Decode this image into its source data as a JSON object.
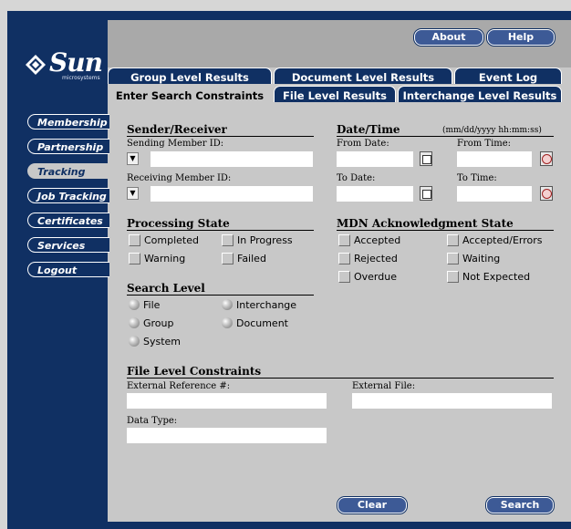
{
  "logo": {
    "word": "Sun",
    "sub": "microsystems"
  },
  "topbar": {
    "about": "About",
    "help": "Help"
  },
  "nav": [
    "Membership",
    "Partnership",
    "Tracking",
    "Job Tracking",
    "Certificates",
    "Services",
    "Logout"
  ],
  "tabs": {
    "row1": [
      "Group Level Results",
      "Document Level Results",
      "Event Log"
    ],
    "row2": [
      "Enter Search Constraints",
      "File Level Results",
      "Interchange Level Results"
    ]
  },
  "sender": {
    "title": "Sender/Receiver",
    "sending_label": "Sending Member ID:",
    "receiving_label": "Receiving Member ID:",
    "sending_value": "",
    "receiving_value": ""
  },
  "datetime": {
    "title": "Date/Time",
    "format": "(mm/dd/yyyy hh:mm:ss)",
    "from_date": "From Date:",
    "from_time": "From Time:",
    "to_date": "To Date:",
    "to_time": "To Time:"
  },
  "processing": {
    "title": "Processing State",
    "options": [
      "Completed",
      "In Progress",
      "Warning",
      "Failed"
    ]
  },
  "mdn": {
    "title": "MDN Acknowledgment State",
    "options": [
      "Accepted",
      "Accepted/Errors",
      "Rejected",
      "Waiting",
      "Overdue",
      "Not Expected"
    ]
  },
  "search_level": {
    "title": "Search Level",
    "options": [
      "File",
      "Interchange",
      "Group",
      "Document",
      "System"
    ]
  },
  "file_level": {
    "title": "File Level Constraints",
    "ext_ref": "External Reference #:",
    "ext_file": "External File:",
    "data_type": "Data Type:"
  },
  "buttons": {
    "clear": "Clear",
    "search": "Search"
  },
  "colors": {
    "frame": "#103063",
    "panel": "#c8c8c8",
    "pill": "#3d5a96"
  }
}
